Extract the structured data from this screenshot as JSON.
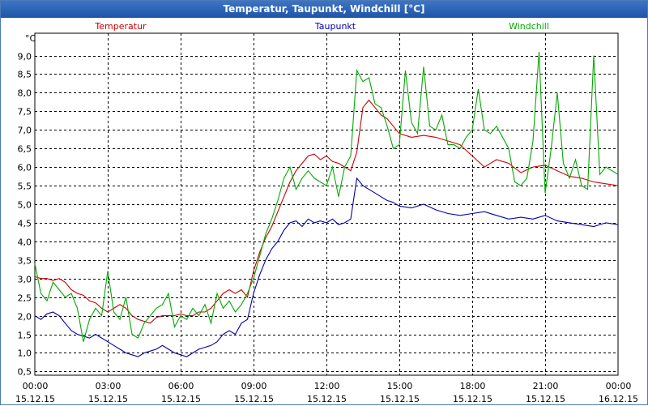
{
  "window": {
    "title": "Temperatur, Taupunkt, Windchill [°C]"
  },
  "chart_data": {
    "type": "line",
    "title": "Temperatur, Taupunkt, Windchill [°C]",
    "ylabel": "°C",
    "ylim": [
      0.4,
      9.6
    ],
    "yticks": [
      0.5,
      1.0,
      1.5,
      2.0,
      2.5,
      3.0,
      3.5,
      4.0,
      4.5,
      5.0,
      5.5,
      6.0,
      6.5,
      7.0,
      7.5,
      8.0,
      8.5,
      9.0
    ],
    "ytick_labels": [
      "0,5",
      "1,0",
      "1,5",
      "2,0",
      "2,5",
      "3,0",
      "3,5",
      "4,0",
      "4,5",
      "5,0",
      "5,5",
      "6,0",
      "6,5",
      "7,0",
      "7,5",
      "8,0",
      "8,5",
      "9,0"
    ],
    "xlim": [
      0,
      24
    ],
    "xticks": [
      0,
      3,
      6,
      9,
      12,
      15,
      18,
      21,
      24
    ],
    "xtick_times": [
      "00:00",
      "03:00",
      "06:00",
      "09:00",
      "12:00",
      "15:00",
      "18:00",
      "21:00",
      "00:00"
    ],
    "xtick_dates": [
      "15.12.15",
      "15.12.15",
      "15.12.15",
      "15.12.15",
      "15.12.15",
      "15.12.15",
      "15.12.15",
      "15.12.15",
      "16.12.15"
    ],
    "grid": true,
    "legend_position": "top",
    "series": [
      {
        "name": "Temperatur",
        "color": "#cc0000",
        "x": [
          0,
          0.25,
          0.5,
          0.75,
          1,
          1.25,
          1.5,
          1.75,
          2,
          2.25,
          2.5,
          2.75,
          3,
          3.25,
          3.5,
          3.75,
          4,
          4.25,
          4.5,
          4.75,
          5,
          5.25,
          5.5,
          5.75,
          6,
          6.25,
          6.5,
          6.75,
          7,
          7.25,
          7.5,
          7.75,
          8,
          8.25,
          8.5,
          8.75,
          9,
          9.25,
          9.5,
          9.75,
          10,
          10.25,
          10.5,
          10.75,
          11,
          11.25,
          11.5,
          11.75,
          12,
          12.25,
          12.5,
          12.75,
          13,
          13.25,
          13.5,
          13.75,
          14,
          14.25,
          14.5,
          14.75,
          15,
          15.5,
          16,
          16.5,
          17,
          17.5,
          18,
          18.5,
          19,
          19.5,
          20,
          20.5,
          21,
          21.5,
          22,
          22.5,
          23,
          23.5,
          24
        ],
        "values": [
          3.05,
          3.0,
          3.0,
          2.95,
          3.0,
          2.9,
          2.7,
          2.6,
          2.55,
          2.4,
          2.35,
          2.2,
          2.1,
          2.2,
          2.3,
          2.2,
          2.0,
          1.9,
          1.85,
          1.8,
          1.95,
          2.0,
          2.0,
          2.0,
          2.05,
          2.0,
          2.0,
          2.1,
          2.1,
          2.2,
          2.4,
          2.6,
          2.7,
          2.6,
          2.7,
          2.5,
          3.2,
          3.7,
          4.1,
          4.4,
          4.8,
          5.2,
          5.6,
          5.9,
          6.1,
          6.3,
          6.35,
          6.2,
          6.3,
          6.15,
          6.1,
          6.0,
          5.9,
          6.4,
          7.6,
          7.8,
          7.6,
          7.4,
          7.3,
          7.1,
          6.9,
          6.8,
          6.85,
          6.8,
          6.7,
          6.6,
          6.3,
          6.0,
          6.2,
          6.1,
          5.85,
          6.0,
          6.05,
          5.9,
          5.75,
          5.7,
          5.6,
          5.55,
          5.5
        ]
      },
      {
        "name": "Taupunkt",
        "color": "#0000b0",
        "x": [
          0,
          0.25,
          0.5,
          0.75,
          1,
          1.25,
          1.5,
          1.75,
          2,
          2.25,
          2.5,
          2.75,
          3,
          3.25,
          3.5,
          3.75,
          4,
          4.25,
          4.5,
          4.75,
          5,
          5.25,
          5.5,
          5.75,
          6,
          6.25,
          6.5,
          6.75,
          7,
          7.25,
          7.5,
          7.75,
          8,
          8.25,
          8.5,
          8.75,
          9,
          9.25,
          9.5,
          9.75,
          10,
          10.25,
          10.5,
          10.75,
          11,
          11.25,
          11.5,
          11.75,
          12,
          12.25,
          12.5,
          12.75,
          13,
          13.25,
          13.5,
          13.75,
          14,
          14.25,
          14.5,
          14.75,
          15,
          15.5,
          16,
          16.5,
          17,
          17.5,
          18,
          18.5,
          19,
          19.5,
          20,
          20.5,
          21,
          21.5,
          22,
          22.5,
          23,
          23.5,
          24
        ],
        "values": [
          2.0,
          1.9,
          2.05,
          2.1,
          2.0,
          1.8,
          1.6,
          1.5,
          1.45,
          1.4,
          1.5,
          1.4,
          1.3,
          1.2,
          1.1,
          1.0,
          0.95,
          0.9,
          1.0,
          1.05,
          1.1,
          1.2,
          1.1,
          1.0,
          0.95,
          0.9,
          1.0,
          1.1,
          1.15,
          1.2,
          1.3,
          1.5,
          1.6,
          1.5,
          1.8,
          1.9,
          2.6,
          3.1,
          3.5,
          3.8,
          4.0,
          4.3,
          4.5,
          4.55,
          4.4,
          4.6,
          4.5,
          4.55,
          4.5,
          4.6,
          4.45,
          4.5,
          4.6,
          5.7,
          5.5,
          5.4,
          5.3,
          5.2,
          5.1,
          5.05,
          4.95,
          4.9,
          5.0,
          4.85,
          4.75,
          4.7,
          4.75,
          4.8,
          4.7,
          4.6,
          4.65,
          4.6,
          4.7,
          4.55,
          4.5,
          4.45,
          4.4,
          4.5,
          4.45
        ]
      },
      {
        "name": "Windchill",
        "color": "#00aa00",
        "x": [
          0,
          0.25,
          0.5,
          0.75,
          1,
          1.25,
          1.5,
          1.75,
          2,
          2.25,
          2.5,
          2.75,
          3,
          3.25,
          3.5,
          3.75,
          4,
          4.25,
          4.5,
          4.75,
          5,
          5.25,
          5.5,
          5.75,
          6,
          6.25,
          6.5,
          6.75,
          7,
          7.25,
          7.5,
          7.75,
          8,
          8.25,
          8.5,
          8.75,
          9,
          9.25,
          9.5,
          9.75,
          10,
          10.25,
          10.5,
          10.75,
          11,
          11.25,
          11.5,
          11.75,
          12,
          12.25,
          12.5,
          12.75,
          13,
          13.25,
          13.5,
          13.75,
          14,
          14.25,
          14.5,
          14.75,
          15,
          15.25,
          15.5,
          15.75,
          16,
          16.25,
          16.5,
          16.75,
          17,
          17.25,
          17.5,
          17.75,
          18,
          18.25,
          18.5,
          18.75,
          19,
          19.25,
          19.5,
          19.75,
          20,
          20.25,
          20.5,
          20.75,
          21,
          21.25,
          21.5,
          21.75,
          22,
          22.25,
          22.5,
          22.75,
          23,
          23.25,
          23.5,
          23.75,
          24
        ],
        "values": [
          3.4,
          2.6,
          2.4,
          2.9,
          2.7,
          2.5,
          2.6,
          2.2,
          1.3,
          1.9,
          2.2,
          2.0,
          3.2,
          2.1,
          1.9,
          2.5,
          1.5,
          1.4,
          1.8,
          2.0,
          2.2,
          2.3,
          2.6,
          1.7,
          2.0,
          1.9,
          2.2,
          2.0,
          2.3,
          1.8,
          2.6,
          2.2,
          2.4,
          2.1,
          2.3,
          2.6,
          3.0,
          3.6,
          4.2,
          4.6,
          5.1,
          5.7,
          6.0,
          5.4,
          5.7,
          5.9,
          5.7,
          5.6,
          5.5,
          6.0,
          5.2,
          6.0,
          6.3,
          8.6,
          8.3,
          8.4,
          7.7,
          7.6,
          7.1,
          6.5,
          6.6,
          8.6,
          7.2,
          6.9,
          8.7,
          7.1,
          7.0,
          7.4,
          6.6,
          6.6,
          6.5,
          6.8,
          7.0,
          8.1,
          7.0,
          6.9,
          7.1,
          6.8,
          6.5,
          5.6,
          5.5,
          5.7,
          6.7,
          9.1,
          5.3,
          6.5,
          8.0,
          6.1,
          5.7,
          6.2,
          5.5,
          5.4,
          9.0,
          5.8,
          6.0,
          5.9,
          5.8
        ]
      }
    ]
  }
}
